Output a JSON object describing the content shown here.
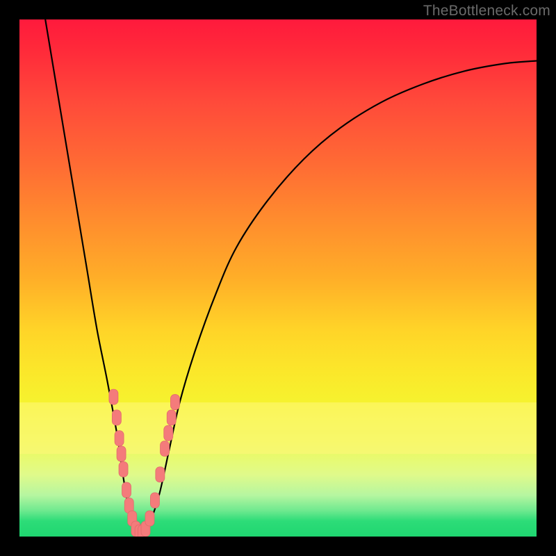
{
  "watermark": "TheBottleneck.com",
  "colors": {
    "frame": "#000000",
    "curve": "#000000",
    "marker_fill": "#f47b7b",
    "marker_stroke": "#e06b6b",
    "gradient_top": "#ff1a3c",
    "gradient_bottom": "#1fd670"
  },
  "chart_data": {
    "type": "line",
    "title": "",
    "xlabel": "",
    "ylabel": "",
    "xlim": [
      0,
      100
    ],
    "ylim": [
      0,
      100
    ],
    "series": [
      {
        "name": "bottleneck-curve",
        "x": [
          5,
          7,
          9,
          11,
          13,
          15,
          17,
          19,
          20,
          21,
          22,
          23,
          24,
          25,
          27,
          29,
          31,
          34,
          38,
          42,
          48,
          55,
          62,
          70,
          78,
          86,
          94,
          100
        ],
        "values": [
          100,
          88,
          76,
          64,
          52,
          40,
          30,
          19,
          12,
          6,
          2,
          0,
          0,
          2,
          8,
          17,
          26,
          36,
          47,
          56,
          65,
          73,
          79,
          84,
          87.5,
          90,
          91.5,
          92
        ]
      }
    ],
    "markers": {
      "name": "highlighted-points",
      "points": [
        {
          "x": 18.2,
          "y": 27
        },
        {
          "x": 18.8,
          "y": 23
        },
        {
          "x": 19.3,
          "y": 19
        },
        {
          "x": 19.7,
          "y": 16
        },
        {
          "x": 20.1,
          "y": 13
        },
        {
          "x": 20.7,
          "y": 9
        },
        {
          "x": 21.2,
          "y": 6
        },
        {
          "x": 21.8,
          "y": 3.5
        },
        {
          "x": 22.5,
          "y": 1.5
        },
        {
          "x": 23.2,
          "y": 0.8
        },
        {
          "x": 23.8,
          "y": 0.8
        },
        {
          "x": 24.4,
          "y": 1.5
        },
        {
          "x": 25.2,
          "y": 3.5
        },
        {
          "x": 26.2,
          "y": 7
        },
        {
          "x": 27.2,
          "y": 12
        },
        {
          "x": 28.1,
          "y": 17
        },
        {
          "x": 28.8,
          "y": 20
        },
        {
          "x": 29.4,
          "y": 23
        },
        {
          "x": 30.1,
          "y": 26
        }
      ]
    }
  }
}
